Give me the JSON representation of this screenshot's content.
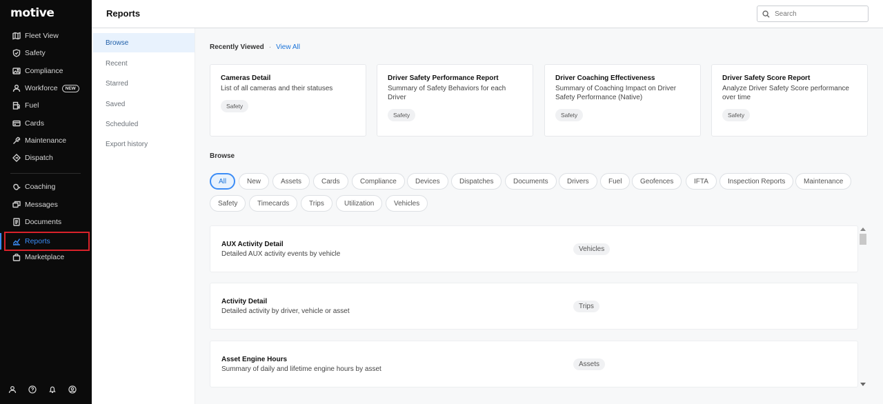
{
  "app": {
    "logo": "motive"
  },
  "leftnav": {
    "items": [
      {
        "label": "Fleet View",
        "icon": "map-icon"
      },
      {
        "label": "Safety",
        "icon": "shield-icon"
      },
      {
        "label": "Compliance",
        "icon": "image-icon"
      },
      {
        "label": "Workforce",
        "icon": "person-icon",
        "badge": "NEW"
      },
      {
        "label": "Fuel",
        "icon": "fuel-icon"
      },
      {
        "label": "Cards",
        "icon": "card-icon"
      },
      {
        "label": "Maintenance",
        "icon": "wrench-icon"
      },
      {
        "label": "Dispatch",
        "icon": "dispatch-icon"
      },
      {
        "label": "Coaching",
        "icon": "coaching-icon"
      },
      {
        "label": "Messages",
        "icon": "messages-icon"
      },
      {
        "label": "Documents",
        "icon": "document-icon"
      },
      {
        "label": "Reports",
        "icon": "chart-icon",
        "active": true
      },
      {
        "label": "Marketplace",
        "icon": "bag-icon"
      }
    ],
    "bottom_icons": [
      "user-icon",
      "help-icon",
      "bell-icon",
      "profile-icon"
    ],
    "accent_color": "#3b8cf6",
    "highlight_color": "#d9222a"
  },
  "header": {
    "title": "Reports",
    "search_placeholder": "Search"
  },
  "subnav": {
    "items": [
      "Browse",
      "Recent",
      "Starred",
      "Saved",
      "Scheduled",
      "Export history"
    ],
    "active": "Browse"
  },
  "recently_viewed": {
    "title": "Recently Viewed",
    "separator": "·",
    "view_all": "View All",
    "cards": [
      {
        "title": "Cameras Detail",
        "desc": "List of all cameras and their statuses",
        "tag": "Safety"
      },
      {
        "title": "Driver Safety Performance Report",
        "desc": "Summary of Safety Behaviors for each Driver",
        "tag": "Safety"
      },
      {
        "title": "Driver Coaching Effectiveness",
        "desc": "Summary of Coaching Impact on Driver Safety Performance (Native)",
        "tag": "Safety"
      },
      {
        "title": "Driver Safety Score Report",
        "desc": "Analyze Driver Safety Score performance over time",
        "tag": "Safety"
      }
    ]
  },
  "browse": {
    "title": "Browse",
    "chips": [
      "All",
      "New",
      "Assets",
      "Cards",
      "Compliance",
      "Devices",
      "Dispatches",
      "Documents",
      "Drivers",
      "Fuel",
      "Geofences",
      "IFTA",
      "Inspection Reports",
      "Maintenance",
      "Safety",
      "Timecards",
      "Trips",
      "Utilization",
      "Vehicles"
    ],
    "active_chip": "All",
    "reports": [
      {
        "title": "AUX Activity Detail",
        "desc": "Detailed AUX activity events by vehicle",
        "tag": "Vehicles"
      },
      {
        "title": "Activity Detail",
        "desc": "Detailed activity by driver, vehicle or asset",
        "tag": "Trips"
      },
      {
        "title": "Asset Engine Hours",
        "desc": "Summary of daily and lifetime engine hours by asset",
        "tag": "Assets"
      }
    ]
  }
}
